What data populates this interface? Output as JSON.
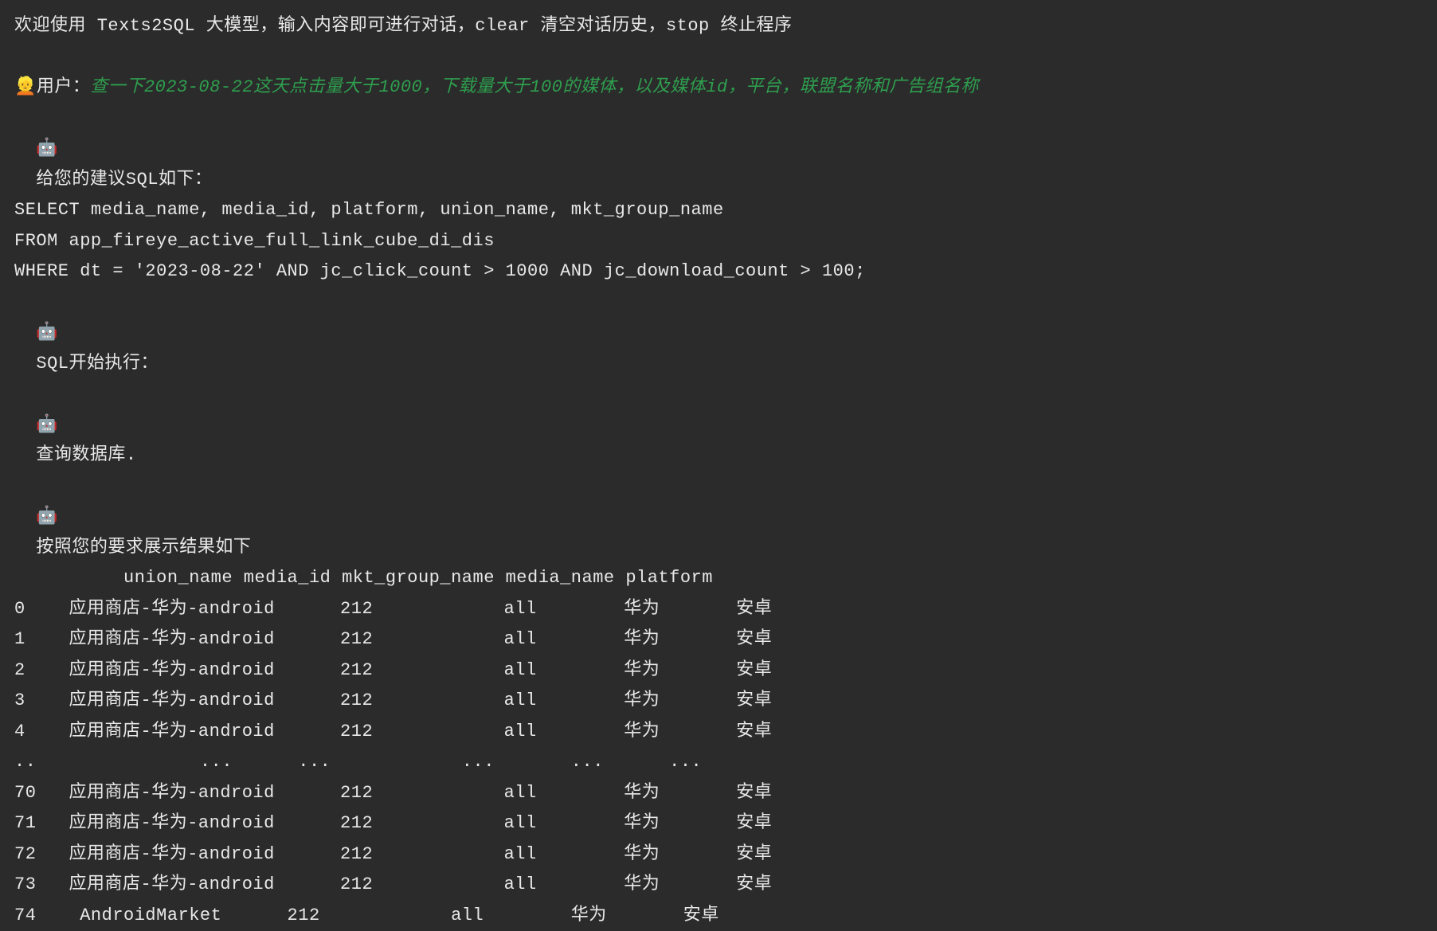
{
  "welcome": "欢迎使用 Texts2SQL 大模型，输入内容即可进行对话，clear 清空对话历史，stop 终止程序",
  "user": {
    "emoji": "👱",
    "prefix": "用户：",
    "query": "查一下2023-08-22这天点击量大于1000，下载量大于100的媒体，以及媒体id，平台，联盟名称和广告组名称"
  },
  "robot": {
    "emoji": "🤖",
    "suggest_label": "给您的建议SQL如下：",
    "sql_lines": [
      "SELECT media_name, media_id, platform, union_name, mkt_group_name",
      "FROM app_fireye_active_full_link_cube_di_dis",
      "WHERE dt = '2023-08-22' AND jc_click_count > 1000 AND jc_download_count > 100;"
    ],
    "exec_label": "SQL开始执行：",
    "query_db_label": "查询数据库.",
    "result_label": "按照您的要求展示结果如下"
  },
  "table": {
    "header": "          union_name media_id mkt_group_name media_name platform",
    "rows": [
      "0    应用商店-华为-android      212            all        华为       安卓",
      "1    应用商店-华为-android      212            all        华为       安卓",
      "2    应用商店-华为-android      212            all        华为       安卓",
      "3    应用商店-华为-android      212            all        华为       安卓",
      "4    应用商店-华为-android      212            all        华为       安卓",
      "..               ...      ...            ...       ...      ...",
      "70   应用商店-华为-android      212            all        华为       安卓",
      "71   应用商店-华为-android      212            all        华为       安卓",
      "72   应用商店-华为-android      212            all        华为       安卓",
      "73   应用商店-华为-android      212            all        华为       安卓",
      "74    AndroidMarket      212            all        华为       安卓"
    ]
  }
}
